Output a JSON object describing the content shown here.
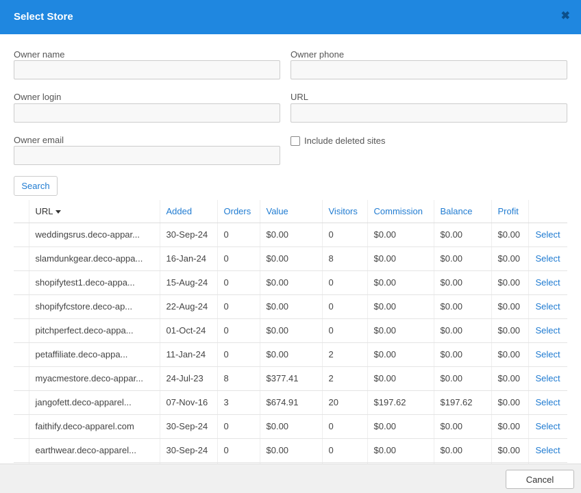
{
  "dialog": {
    "title": "Select Store",
    "close_icon": "close-icon"
  },
  "form": {
    "owner_name": {
      "label": "Owner name",
      "value": ""
    },
    "owner_phone": {
      "label": "Owner phone",
      "value": ""
    },
    "owner_login": {
      "label": "Owner login",
      "value": ""
    },
    "url": {
      "label": "URL",
      "value": ""
    },
    "owner_email": {
      "label": "Owner email",
      "value": ""
    },
    "include_deleted": {
      "label": "Include deleted sites",
      "checked": false
    },
    "search_label": "Search"
  },
  "table": {
    "headers": [
      "URL",
      "Added",
      "Orders",
      "Value",
      "Visitors",
      "Commission",
      "Balance",
      "Profit"
    ],
    "sort_column": "URL",
    "sort_direction": "descending",
    "action_label": "Select",
    "rows": [
      [
        "weddingsrus.deco-appar...",
        "30-Sep-24",
        "0",
        "$0.00",
        "0",
        "$0.00",
        "$0.00",
        "$0.00"
      ],
      [
        "slamdunkgear.deco-appa...",
        "16-Jan-24",
        "0",
        "$0.00",
        "8",
        "$0.00",
        "$0.00",
        "$0.00"
      ],
      [
        "shopifytest1.deco-appa...",
        "15-Aug-24",
        "0",
        "$0.00",
        "0",
        "$0.00",
        "$0.00",
        "$0.00"
      ],
      [
        "shopifyfcstore.deco-ap...",
        "22-Aug-24",
        "0",
        "$0.00",
        "0",
        "$0.00",
        "$0.00",
        "$0.00"
      ],
      [
        "pitchperfect.deco-appa...",
        "01-Oct-24",
        "0",
        "$0.00",
        "0",
        "$0.00",
        "$0.00",
        "$0.00"
      ],
      [
        "petaffiliate.deco-appa...",
        "11-Jan-24",
        "0",
        "$0.00",
        "2",
        "$0.00",
        "$0.00",
        "$0.00"
      ],
      [
        "myacmestore.deco-appar...",
        "24-Jul-23",
        "8",
        "$377.41",
        "2",
        "$0.00",
        "$0.00",
        "$0.00"
      ],
      [
        "jangofett.deco-apparel...",
        "07-Nov-16",
        "3",
        "$674.91",
        "20",
        "$197.62",
        "$197.62",
        "$0.00"
      ],
      [
        "faithify.deco-apparel.com",
        "30-Sep-24",
        "0",
        "$0.00",
        "0",
        "$0.00",
        "$0.00",
        "$0.00"
      ],
      [
        "earthwear.deco-apparel...",
        "30-Sep-24",
        "0",
        "$0.00",
        "0",
        "$0.00",
        "$0.00",
        "$0.00"
      ],
      [
        "",
        "",
        "",
        "",
        "",
        "",
        "",
        ""
      ]
    ]
  },
  "footer": {
    "cancel_label": "Cancel"
  },
  "colors": {
    "accent": "#1f87e0",
    "link": "#1f7bd1"
  }
}
